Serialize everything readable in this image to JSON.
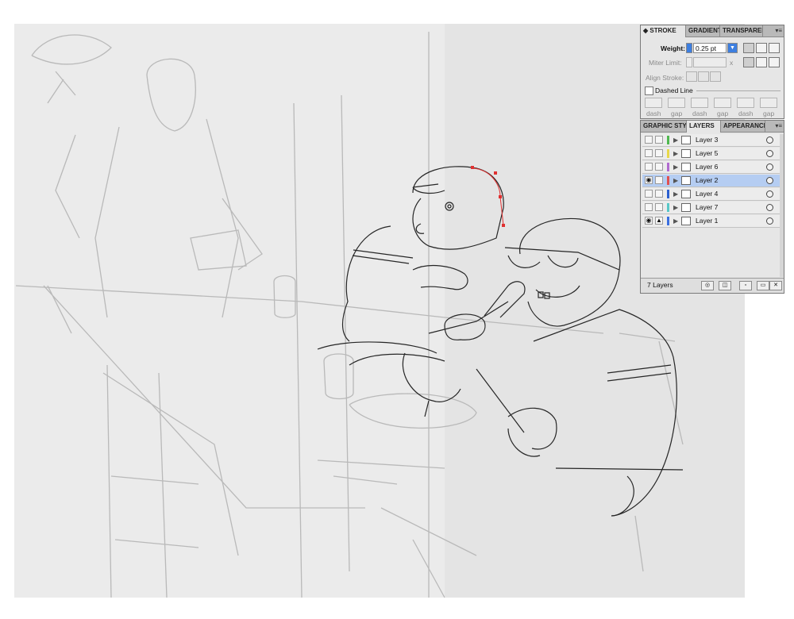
{
  "stroke_panel": {
    "tabs": [
      "STROKE",
      "GRADIENT",
      "TRANSPAREN"
    ],
    "weight_label": "Weight:",
    "weight_value": "0.25 pt",
    "miter_label": "Miter Limit:",
    "miter_x": "x",
    "align_label": "Align Stroke:",
    "dashed_label": "Dashed Line",
    "dash_labels": [
      "dash",
      "gap",
      "dash",
      "gap",
      "dash",
      "gap"
    ]
  },
  "layers_panel": {
    "tabs": [
      "GRAPHIC STY",
      "LAYERS",
      "APPEARANCE"
    ],
    "layers": [
      {
        "name": "Layer 3",
        "color": "#4fb84f",
        "visible": false,
        "locked": false,
        "selected": false
      },
      {
        "name": "Layer 5",
        "color": "#e8d84a",
        "visible": false,
        "locked": false,
        "selected": false
      },
      {
        "name": "Layer 6",
        "color": "#b06ad0",
        "visible": false,
        "locked": false,
        "selected": false
      },
      {
        "name": "Layer 2",
        "color": "#e05050",
        "visible": true,
        "locked": false,
        "selected": true
      },
      {
        "name": "Layer 4",
        "color": "#2a5fd0",
        "visible": false,
        "locked": false,
        "selected": false
      },
      {
        "name": "Layer 7",
        "color": "#57c8c8",
        "visible": false,
        "locked": false,
        "selected": false
      },
      {
        "name": "Layer 1",
        "color": "#3a6fe0",
        "visible": true,
        "locked": true,
        "selected": false
      }
    ],
    "footer_count": "7 Layers"
  },
  "colors": {
    "panel_bg": "#e6e6e6",
    "selection": "#b5cdf2",
    "path_highlight": "#e03030"
  }
}
